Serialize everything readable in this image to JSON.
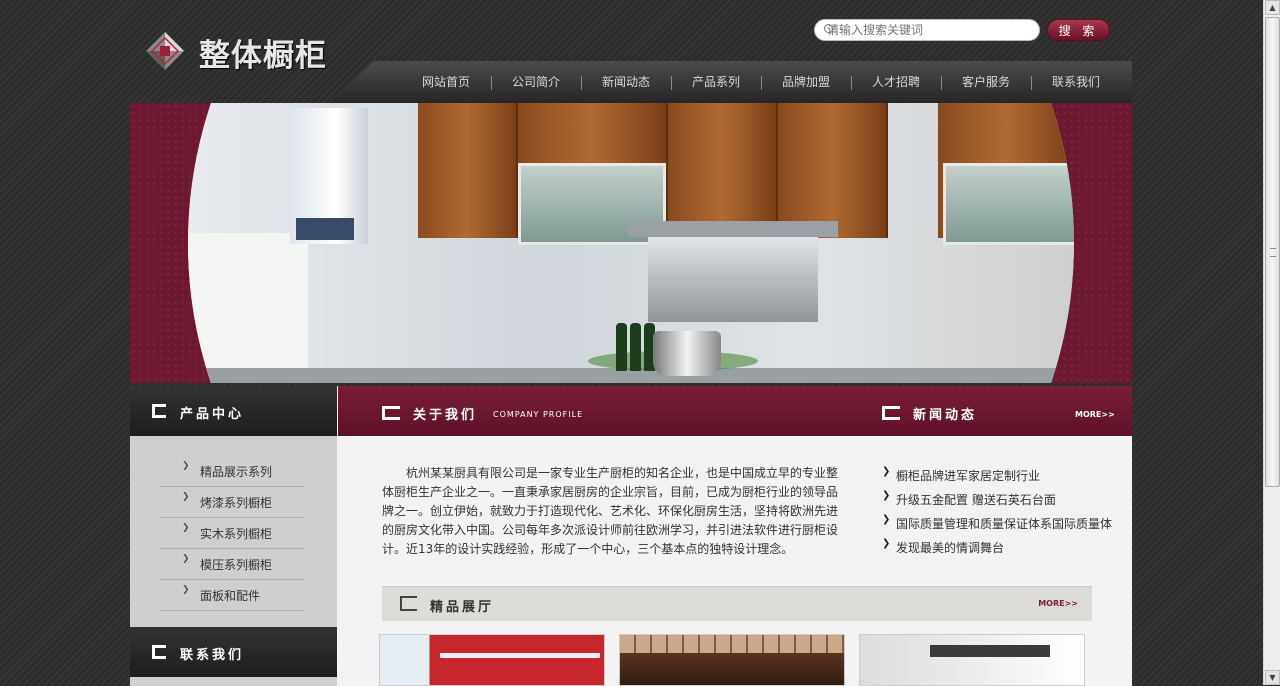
{
  "header": {
    "logo_text": "整体橱柜",
    "search_placeholder": "请输入搜索关键词",
    "search_button": "搜 索"
  },
  "nav": {
    "items": [
      "网站首页",
      "公司简介",
      "新闻动态",
      "产品系列",
      "品牌加盟",
      "人才招聘",
      "客户服务",
      "联系我们"
    ]
  },
  "sidebar": {
    "products_title": "产品中心",
    "items": [
      "精品展示系列",
      "烤漆系列橱柜",
      "实木系列橱柜",
      "模压系列橱柜",
      "面板和配件"
    ],
    "contact_title": "联系我们"
  },
  "about": {
    "title": "关于我们",
    "subtitle": "COMPANY PROFILE",
    "text": "杭州某某厨具有限公司是一家专业生产厨柜的知名企业，也是中国成立早的专业整体厨柜生产企业之一。一直秉承家居厨房的企业宗旨，目前，已成为厨柜行业的领导品牌之一。创立伊始，就致力于打造现代化、艺术化、环保化厨房生活，坚持将欧洲先进的厨房文化带入中国。公司每年多次派设计师前往欧洲学习，并引进法软件进行厨柜设计。近13年的设计实践经验，形成了一个中心，三个基本点的独特设计理念。"
  },
  "news": {
    "title": "新闻动态",
    "more": "MORE>>",
    "items": [
      "橱柜品牌进军家居定制行业",
      "升级五金配置 赠送石英石台面",
      "国际质量管理和质量保证体系国际质量体",
      "发现最美的情调舞台"
    ]
  },
  "showroom": {
    "title": "精品展厅",
    "more": "MORE>>"
  },
  "colors": {
    "accent": "#6d1730",
    "dark": "#262626"
  },
  "icons": {
    "logo": "diamond-logo-icon",
    "search": "search-icon",
    "bullet": "chevron-right-icon"
  }
}
